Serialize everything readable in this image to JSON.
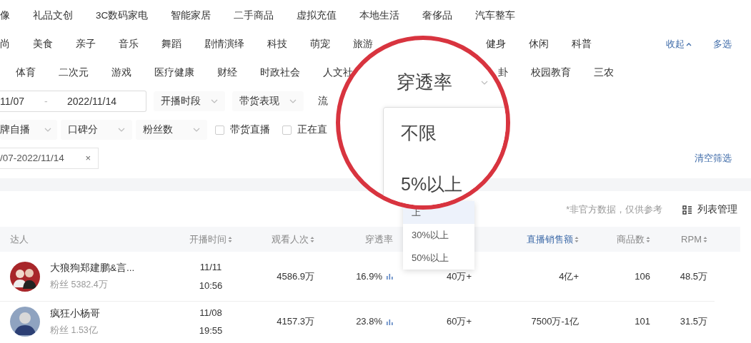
{
  "category_rows": [
    {
      "items": [
        "像",
        "礼品文创",
        "3C数码家电",
        "智能家居",
        "二手商品",
        "虚拟充值",
        "本地生活",
        "奢侈品",
        "汽车整车"
      ]
    },
    {
      "items": [
        "尚",
        "美食",
        "亲子",
        "音乐",
        "舞蹈",
        "剧情演绎",
        "科技",
        "萌宠",
        "旅游"
      ],
      "items_right": [
        "健身",
        "休闲",
        "科普"
      ]
    },
    {
      "items": [
        "体育",
        "二次元",
        "游戏",
        "医疗健康",
        "财经",
        "时政社会",
        "人文社"
      ],
      "items_right": [
        "卦",
        "校园教育",
        "三农"
      ]
    }
  ],
  "category_actions": [
    {
      "label": "收起",
      "kind": "collapse"
    },
    {
      "label": "多选",
      "kind": "multi"
    }
  ],
  "date_range": {
    "start": "11/07",
    "separator": "-",
    "end": "2022/11/14"
  },
  "filter_row_1": [
    {
      "kind": "select",
      "label": "开播时段"
    },
    {
      "kind": "select",
      "label": "带货表现"
    },
    {
      "kind": "text",
      "label": "流"
    }
  ],
  "filter_row_2": [
    {
      "kind": "select",
      "label": "牌自播"
    },
    {
      "kind": "select",
      "label": "口碑分"
    },
    {
      "kind": "select",
      "label": "粉丝数"
    },
    {
      "kind": "checkbox",
      "label": "带货直播",
      "checked": false
    },
    {
      "kind": "checkbox",
      "label": "正在直",
      "checked": false
    }
  ],
  "active_tags": [
    {
      "label": "/07-2022/11/14",
      "close": "×"
    }
  ],
  "clear_filters": "清空筛选",
  "magnifier": {
    "title": "穿透率",
    "options": [
      "不限",
      "5%以上"
    ]
  },
  "dropdown": {
    "options": [
      {
        "label": "上",
        "selected": true
      },
      {
        "label": "30%以上",
        "selected": false
      },
      {
        "label": "50%以上",
        "selected": false
      }
    ]
  },
  "table": {
    "note": "*非官方数据，仅供参考",
    "manage": "列表管理",
    "columns": [
      {
        "label": "达人",
        "sortable": false,
        "active": false
      },
      {
        "label": "开播时间",
        "sortable": true,
        "active": false
      },
      {
        "label": "观看人次",
        "sortable": true,
        "active": false
      },
      {
        "label": "穿透率",
        "sortable": false,
        "active": false
      },
      {
        "label": "直播销售额",
        "sortable": true,
        "active": true
      },
      {
        "label": "商品数",
        "sortable": true,
        "active": false
      },
      {
        "label": "RPM",
        "sortable": true,
        "active": false
      }
    ],
    "rows": [
      {
        "name": "大狼狗郑建鹏&言...",
        "fans": "粉丝 5382.4万",
        "date": "11/11",
        "time": "10:56",
        "views": "4586.9万",
        "rate": "16.9%",
        "column_5": "40万+",
        "sales": "4亿+",
        "products": "106",
        "rpm": "48.5万"
      },
      {
        "name": "疯狂小杨哥",
        "fans": "粉丝 1.53亿",
        "date": "11/08",
        "time": "19:55",
        "views": "4157.3万",
        "rate": "23.8%",
        "column_5": "60万+",
        "sales": "7500万-1亿",
        "products": "101",
        "rpm": "31.5万"
      }
    ]
  }
}
